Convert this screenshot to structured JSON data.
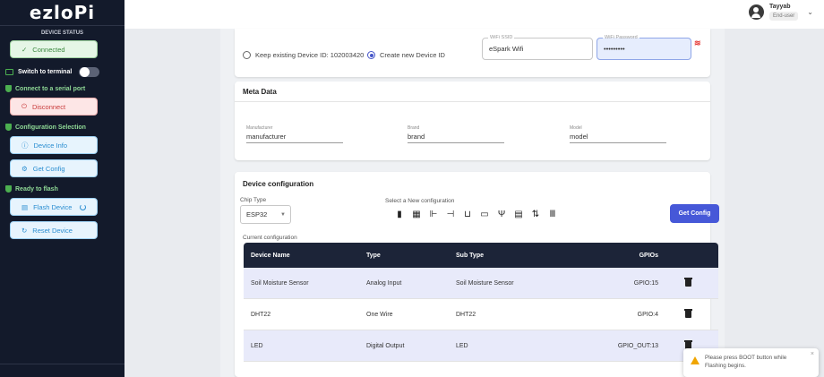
{
  "brand": "ezloPi",
  "sidebar": {
    "status_heading": "DEVICE STATUS",
    "connected": "Connected",
    "switch_terminal": "Switch to terminal",
    "connect_serial": "Connect to a serial port",
    "disconnect": "Disconnect",
    "config_selection": "Configuration Selection",
    "device_info": "Device Info",
    "get_config": "Get Config",
    "ready": "Ready to flash",
    "flash_device": "Flash Device",
    "reset_device": "Reset Device"
  },
  "user": {
    "name": "Tayyab",
    "role": "End-user"
  },
  "wifi": {
    "keep_label": "Keep existing Device ID: 102003420",
    "create_label": "Create new Device ID",
    "ssid_label": "WiFi SSID",
    "ssid_value": "eSpark Wifi",
    "pwd_label": "WiFi Password",
    "pwd_value": "•••••••••"
  },
  "meta": {
    "title": "Meta Data",
    "manufacturer_label": "Manufacturer",
    "manufacturer_value": "manufacturer",
    "brand_label": "Brand",
    "brand_value": "brand",
    "model_label": "Model",
    "model_value": "model"
  },
  "device_config": {
    "title": "Device configuration",
    "chip_label": "Chip Type",
    "chip_value": "ESP32",
    "select_label": "Select a New configuration",
    "get_config": "Get Config",
    "current_label": "Current configuration",
    "headers": [
      "Device Name",
      "Type",
      "Sub Type",
      "GPIOs"
    ],
    "rows": [
      {
        "name": "Soil Moisture Sensor",
        "type": "Analog Input",
        "sub": "Soil Moisture Sensor",
        "gpio": "GPIO:15"
      },
      {
        "name": "DHT22",
        "type": "One Wire",
        "sub": "DHT22",
        "gpio": "GPIO:4"
      },
      {
        "name": "LED",
        "type": "Digital Output",
        "sub": "LED",
        "gpio": "GPIO_OUT:13"
      }
    ]
  },
  "toast": {
    "text": "Please press BOOT button while Flashing begins.",
    "close": "×"
  },
  "icons": {
    "wifi_off": "wifi-off-icon"
  }
}
